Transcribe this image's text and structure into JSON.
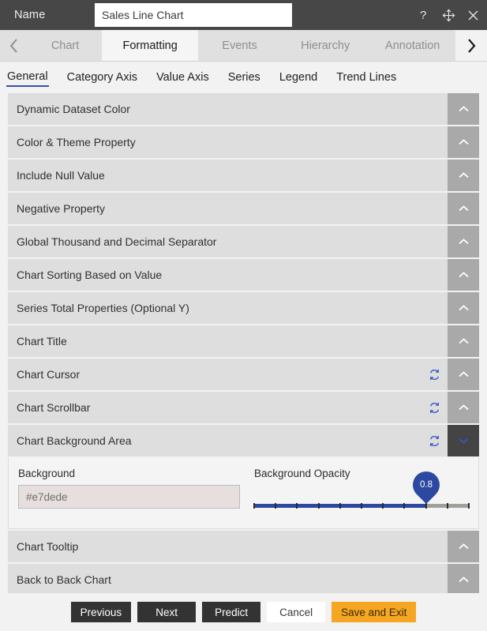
{
  "header": {
    "name_label": "Name",
    "name_value": "Sales Line Chart",
    "icons": {
      "help": "?",
      "move": "✥",
      "close": "✕"
    }
  },
  "tabbar": {
    "prev_arrow": "chevron-left-icon",
    "next_arrow": "chevron-right-icon",
    "tabs": [
      {
        "label": "Chart",
        "active": false
      },
      {
        "label": "Formatting",
        "active": true
      },
      {
        "label": "Events",
        "active": false
      },
      {
        "label": "Hierarchy",
        "active": false
      },
      {
        "label": "Annotation",
        "active": false
      }
    ]
  },
  "subtabs": [
    {
      "label": "General",
      "active": true
    },
    {
      "label": "Category Axis",
      "active": false
    },
    {
      "label": "Value Axis",
      "active": false
    },
    {
      "label": "Series",
      "active": false
    },
    {
      "label": "Legend",
      "active": false
    },
    {
      "label": "Trend Lines",
      "active": false
    }
  ],
  "sections": [
    {
      "label": "Dynamic Dataset Color",
      "expanded": false,
      "refresh": false
    },
    {
      "label": "Color & Theme Property",
      "expanded": false,
      "refresh": false
    },
    {
      "label": "Include Null Value",
      "expanded": false,
      "refresh": false
    },
    {
      "label": "Negative Property",
      "expanded": false,
      "refresh": false
    },
    {
      "label": "Global Thousand and Decimal Separator",
      "expanded": false,
      "refresh": false
    },
    {
      "label": "Chart Sorting Based on Value",
      "expanded": false,
      "refresh": false
    },
    {
      "label": "Series Total Properties (Optional Y)",
      "expanded": false,
      "refresh": false
    },
    {
      "label": "Chart Title",
      "expanded": false,
      "refresh": false
    },
    {
      "label": "Chart Cursor",
      "expanded": false,
      "refresh": true
    },
    {
      "label": "Chart Scrollbar",
      "expanded": false,
      "refresh": true
    },
    {
      "label": "Chart Background Area",
      "expanded": true,
      "refresh": true
    },
    {
      "label": "Chart Tooltip",
      "expanded": false,
      "refresh": false
    },
    {
      "label": "Back to Back Chart",
      "expanded": false,
      "refresh": false
    }
  ],
  "background_area": {
    "background_label": "Background",
    "background_value": "#e7dede",
    "opacity_label": "Background Opacity",
    "opacity_value": "0.8",
    "opacity_min": 0,
    "opacity_max": 1,
    "opacity_step": 0.1
  },
  "footer": {
    "previous": "Previous",
    "next": "Next",
    "predict": "Predict",
    "cancel": "Cancel",
    "save_exit": "Save and Exit"
  },
  "colors": {
    "titlebar": "#474747",
    "accent_orange": "#f5a623",
    "slider_blue": "#2c48a0",
    "row_gray": "#dedede",
    "chevron_gray": "#a9a9a9",
    "chevron_dark": "#444444"
  }
}
